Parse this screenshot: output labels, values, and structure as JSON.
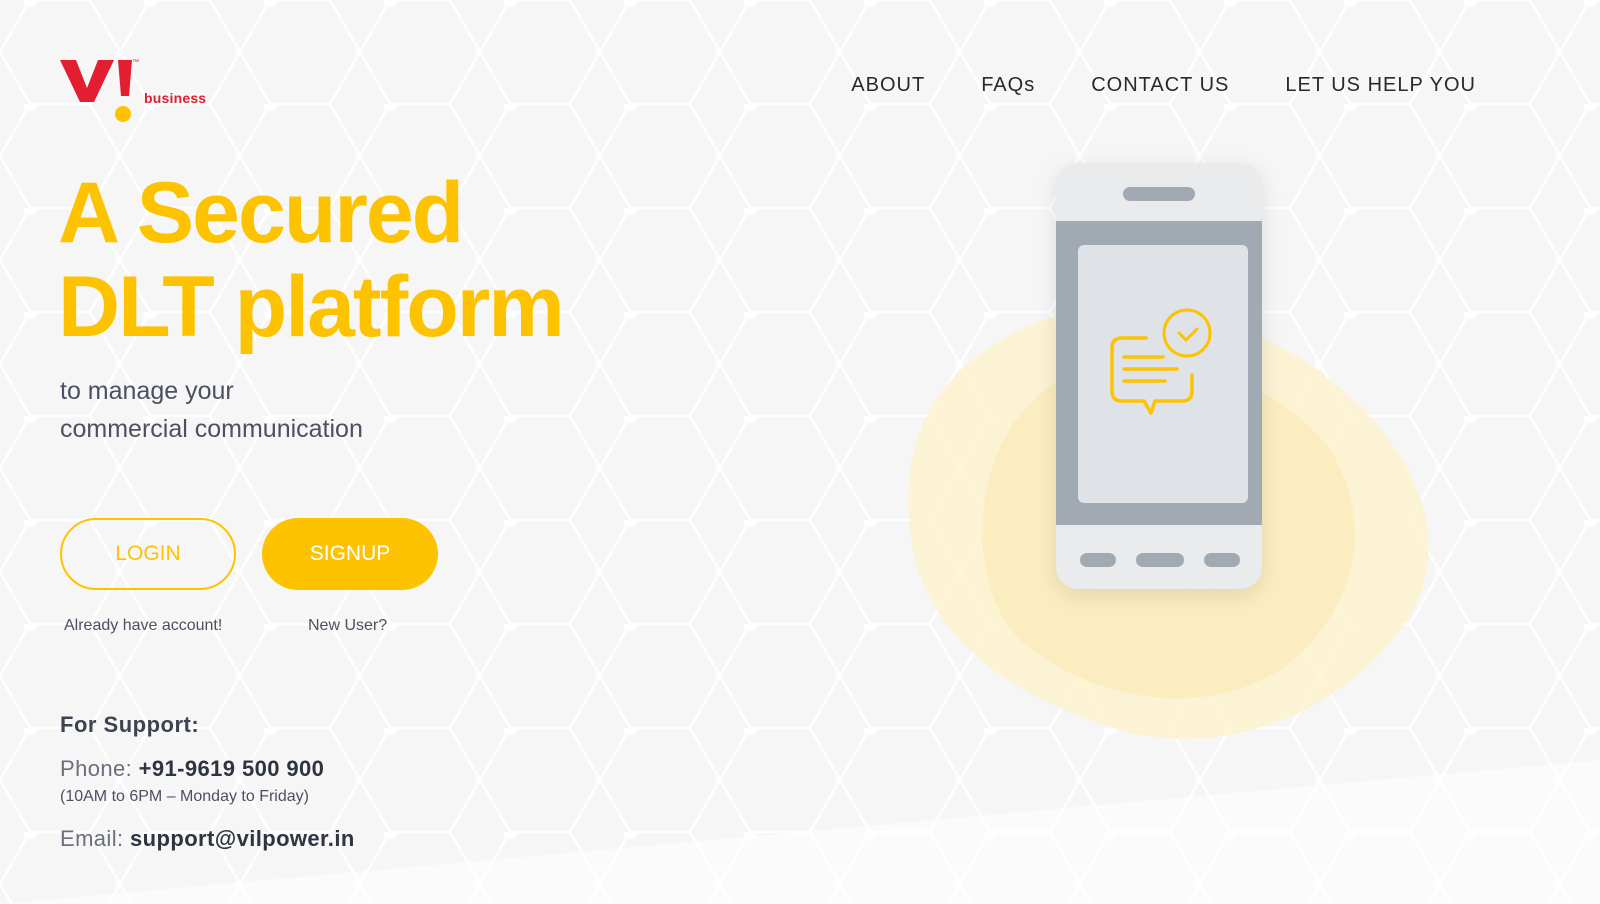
{
  "brand": {
    "logo_text": "VI",
    "trademark": "™",
    "sub_label": "business",
    "colors": {
      "red": "#e31e30",
      "yellow": "#fdc300"
    }
  },
  "nav": {
    "items": [
      {
        "label": "ABOUT"
      },
      {
        "label": "FAQs"
      },
      {
        "label": "CONTACT US"
      },
      {
        "label": "LET US HELP YOU"
      }
    ]
  },
  "hero": {
    "title_line1": "A Secured",
    "title_line2": "DLT platform",
    "subtitle_line1": "to manage your",
    "subtitle_line2": "commercial communication"
  },
  "actions": {
    "login_label": "LOGIN",
    "login_caption": "Already have account!",
    "signup_label": "SIGNUP",
    "signup_caption": "New User?"
  },
  "support": {
    "title": "For Support:",
    "phone_label": "Phone:",
    "phone_value": "+91-9619 500 900",
    "hours": "(10AM to 6PM – Monday to Friday)",
    "email_label": "Email:",
    "email_value": "support@vilpower.in"
  },
  "illustration": {
    "icons": [
      "smartphone-icon",
      "message-bubble-icon",
      "check-circle-icon"
    ]
  }
}
